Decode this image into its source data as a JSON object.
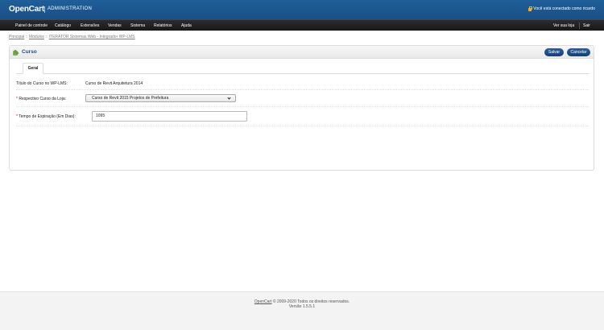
{
  "header": {
    "logo": "OpenCart",
    "subtitle": "ADMINISTRATION",
    "login_text": "Você está conectado como ricardo"
  },
  "menu": {
    "items": [
      "Painel de controle",
      "Catálogo",
      "Extensões",
      "Vendas",
      "Sistema",
      "Relatórios",
      "Ajuda"
    ],
    "store_link": "Ver sua loja",
    "logout": "Sair"
  },
  "breadcrumb": [
    "Principal",
    "Módulos",
    "ITERATOR Sistemas Web - Integrador WP-LMS"
  ],
  "box": {
    "title": "Curso",
    "save_label": "Salvar",
    "cancel_label": "Cancelar",
    "tab_general": "Geral"
  },
  "form": {
    "title_label": "Título do Curso no WP-LMS:",
    "title_value": "Curso de Revit Arquitetura 2014",
    "required_mark": "*",
    "store_course_label": "Respectivo Curso da Loja:",
    "store_course_selected": "Curso de Revit 2015 Projetos de Prefeitura",
    "expiration_label": "Tempo de Expiração (Em Dias):",
    "expiration_value": "1095"
  },
  "footer": {
    "link": "OpenCart",
    "copyright": "© 2009-2020 Todos os direitos reservados.",
    "version": "Versão 1.5.5.1"
  },
  "colors": {
    "header_blue": "#1f5f9a",
    "menu_dark": "#2c2c2c",
    "button_blue": "#2a5f9e",
    "title_blue": "#1d4f86",
    "required_red": "#cc0000"
  }
}
